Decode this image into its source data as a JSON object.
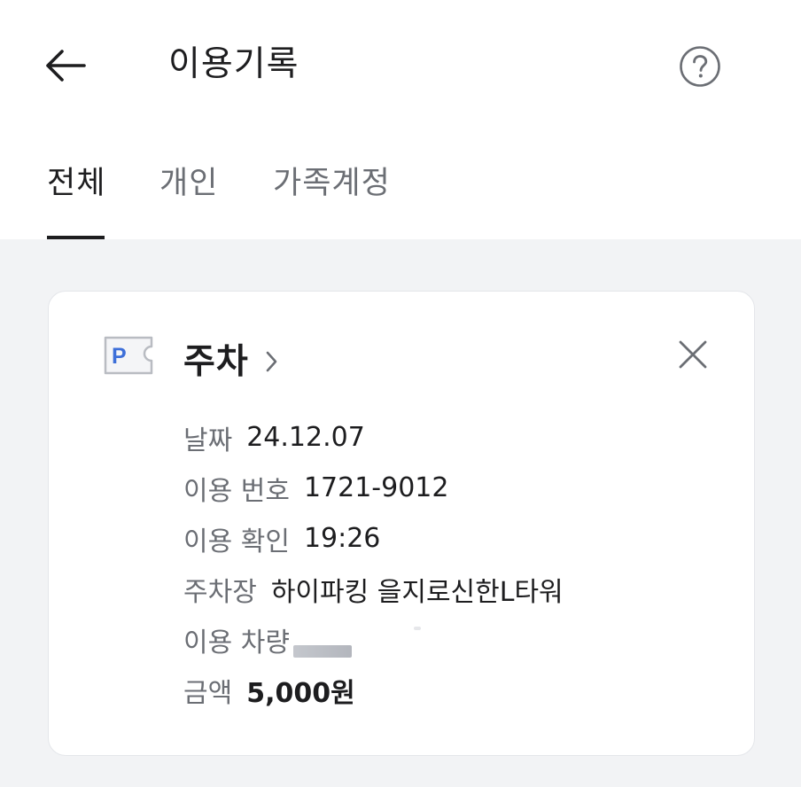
{
  "header": {
    "title": "이용기록",
    "back_icon": "arrow-left-icon",
    "help_icon": "question-circle-icon"
  },
  "tabs": [
    {
      "label": "전체",
      "active": true
    },
    {
      "label": "개인",
      "active": false
    },
    {
      "label": "가족계정",
      "active": false
    }
  ],
  "record": {
    "icon": "parking-ticket-icon",
    "title": "주차",
    "details": [
      {
        "label": "날짜",
        "value": "24.12.07"
      },
      {
        "label": "이용 번호",
        "value": "1721-9012"
      },
      {
        "label": "이용 확인",
        "value": "19:26"
      },
      {
        "label": "주차장",
        "value": "하이파킹 을지로신한L타워"
      },
      {
        "label": "이용 차량",
        "value": ""
      },
      {
        "label": "금액",
        "value": "5,000원"
      }
    ]
  },
  "colors": {
    "background": "#f2f3f5",
    "primary_text": "#1d1d1f",
    "secondary_text": "#6b6e74",
    "parking_blue": "#3d6fd9"
  }
}
